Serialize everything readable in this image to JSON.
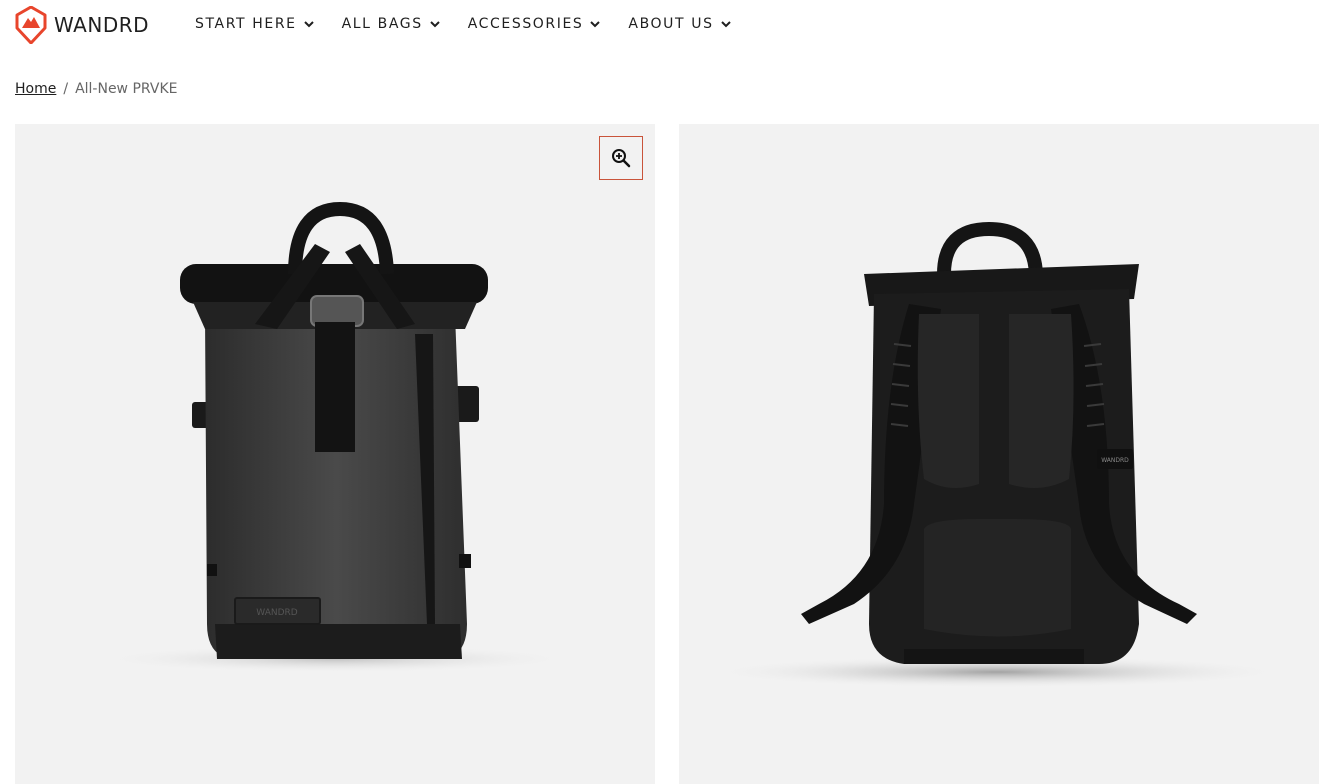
{
  "brand": {
    "name": "WANDRD",
    "accent": "#e8452c"
  },
  "nav": {
    "items": [
      {
        "label": "START HERE"
      },
      {
        "label": "ALL BAGS"
      },
      {
        "label": "ACCESSORIES"
      },
      {
        "label": "ABOUT US"
      }
    ]
  },
  "breadcrumb": {
    "home": "Home",
    "separator": "/",
    "current": "All-New PRVKE"
  },
  "gallery": {
    "zoom_icon": "zoom-in-icon",
    "images": [
      {
        "alt": "PRVKE backpack front view",
        "tag": "WANDRD"
      },
      {
        "alt": "PRVKE backpack back view",
        "tag": "WANDRD"
      }
    ]
  }
}
